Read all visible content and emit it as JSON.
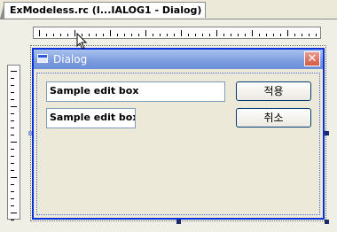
{
  "tab": {
    "title": "ExModeless.rc (I...IALOG1 - Dialog)"
  },
  "dialog": {
    "title": "Dialog",
    "close_symbol": "✕",
    "edit_boxes": [
      {
        "text": "Sample edit box"
      },
      {
        "text": "Sample edit box"
      }
    ],
    "buttons": [
      {
        "label": "적용"
      },
      {
        "label": "취소"
      }
    ]
  },
  "icons": [
    "window-icon",
    "close-icon",
    "mouse-cursor-icon"
  ],
  "colors": {
    "titlebar": "#7f9ee0",
    "dialog_border": "#0831d9",
    "face": "#ece9d8",
    "close": "#d55a44"
  }
}
